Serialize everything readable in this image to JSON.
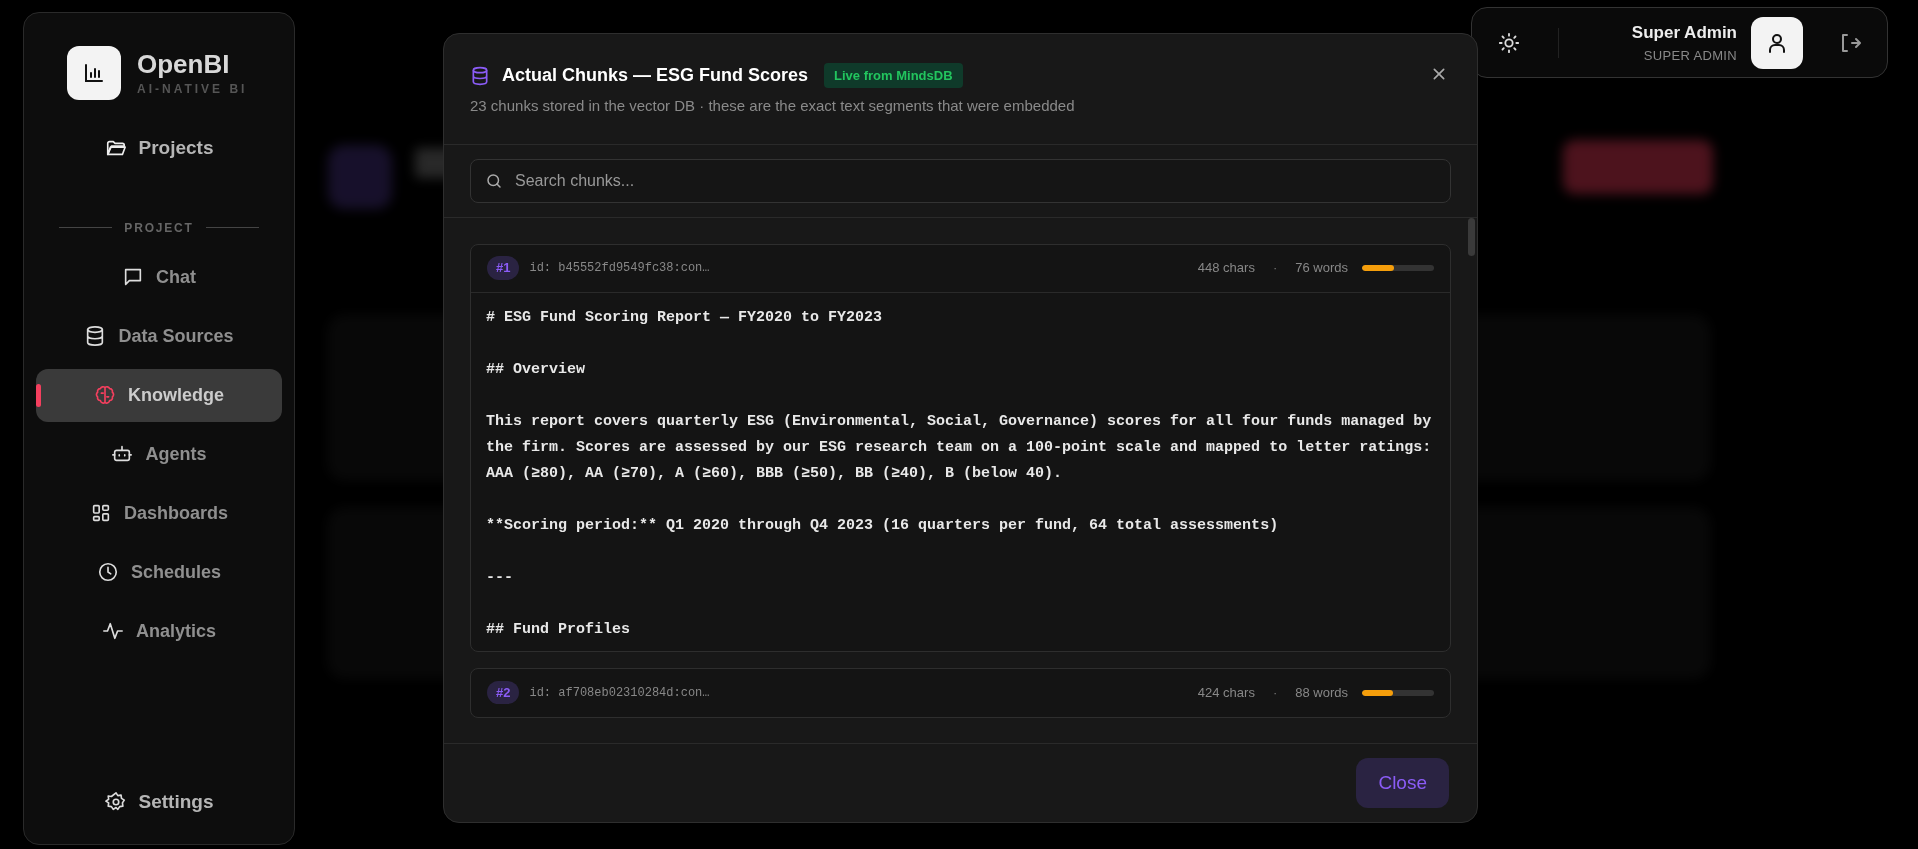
{
  "brand": {
    "name": "OpenBI",
    "tagline": "AI-NATIVE BI"
  },
  "nav_top": {
    "label": "Projects"
  },
  "section_label": "PROJECT",
  "nav": [
    {
      "label": "Chat",
      "selected": false
    },
    {
      "label": "Data Sources",
      "selected": false
    },
    {
      "label": "Knowledge",
      "selected": true
    },
    {
      "label": "Agents",
      "selected": false
    },
    {
      "label": "Dashboards",
      "selected": false
    },
    {
      "label": "Schedules",
      "selected": false
    },
    {
      "label": "Analytics",
      "selected": false
    }
  ],
  "nav_bottom": {
    "label": "Settings"
  },
  "user": {
    "name": "Super Admin",
    "role": "SUPER ADMIN"
  },
  "modal": {
    "title": "Actual Chunks — ESG Fund Scores",
    "badge": "Live from MindsDB",
    "subtitle": "23 chunks stored in the vector DB · these are the exact text segments that were embedded",
    "search": {
      "placeholder": "Search chunks..."
    },
    "chunks": [
      {
        "index": "#1",
        "id": "id: b45552fd9549fc38:con…",
        "chars": "448 chars",
        "separator": "·",
        "words": "76 words",
        "level": 0.45,
        "text": "# ESG Fund Scoring Report — FY2020 to FY2023\n\n## Overview\n\nThis report covers quarterly ESG (Environmental, Social, Governance) scores for all four funds managed by the firm. Scores are assessed by our ESG research team on a 100-point scale and mapped to letter ratings: AAA (≥80), AA (≥70), A (≥60), BBB (≥50), BB (≥40), B (below 40).\n\n**Scoring period:** Q1 2020 through Q4 2023 (16 quarters per fund, 64 total assessments)\n\n---\n\n## Fund Profiles"
      },
      {
        "index": "#2",
        "id": "id: af708eb02310284d:con…",
        "chars": "424 chars",
        "separator": "·",
        "words": "88 words",
        "level": 0.43
      }
    ],
    "close_label": "Close"
  }
}
